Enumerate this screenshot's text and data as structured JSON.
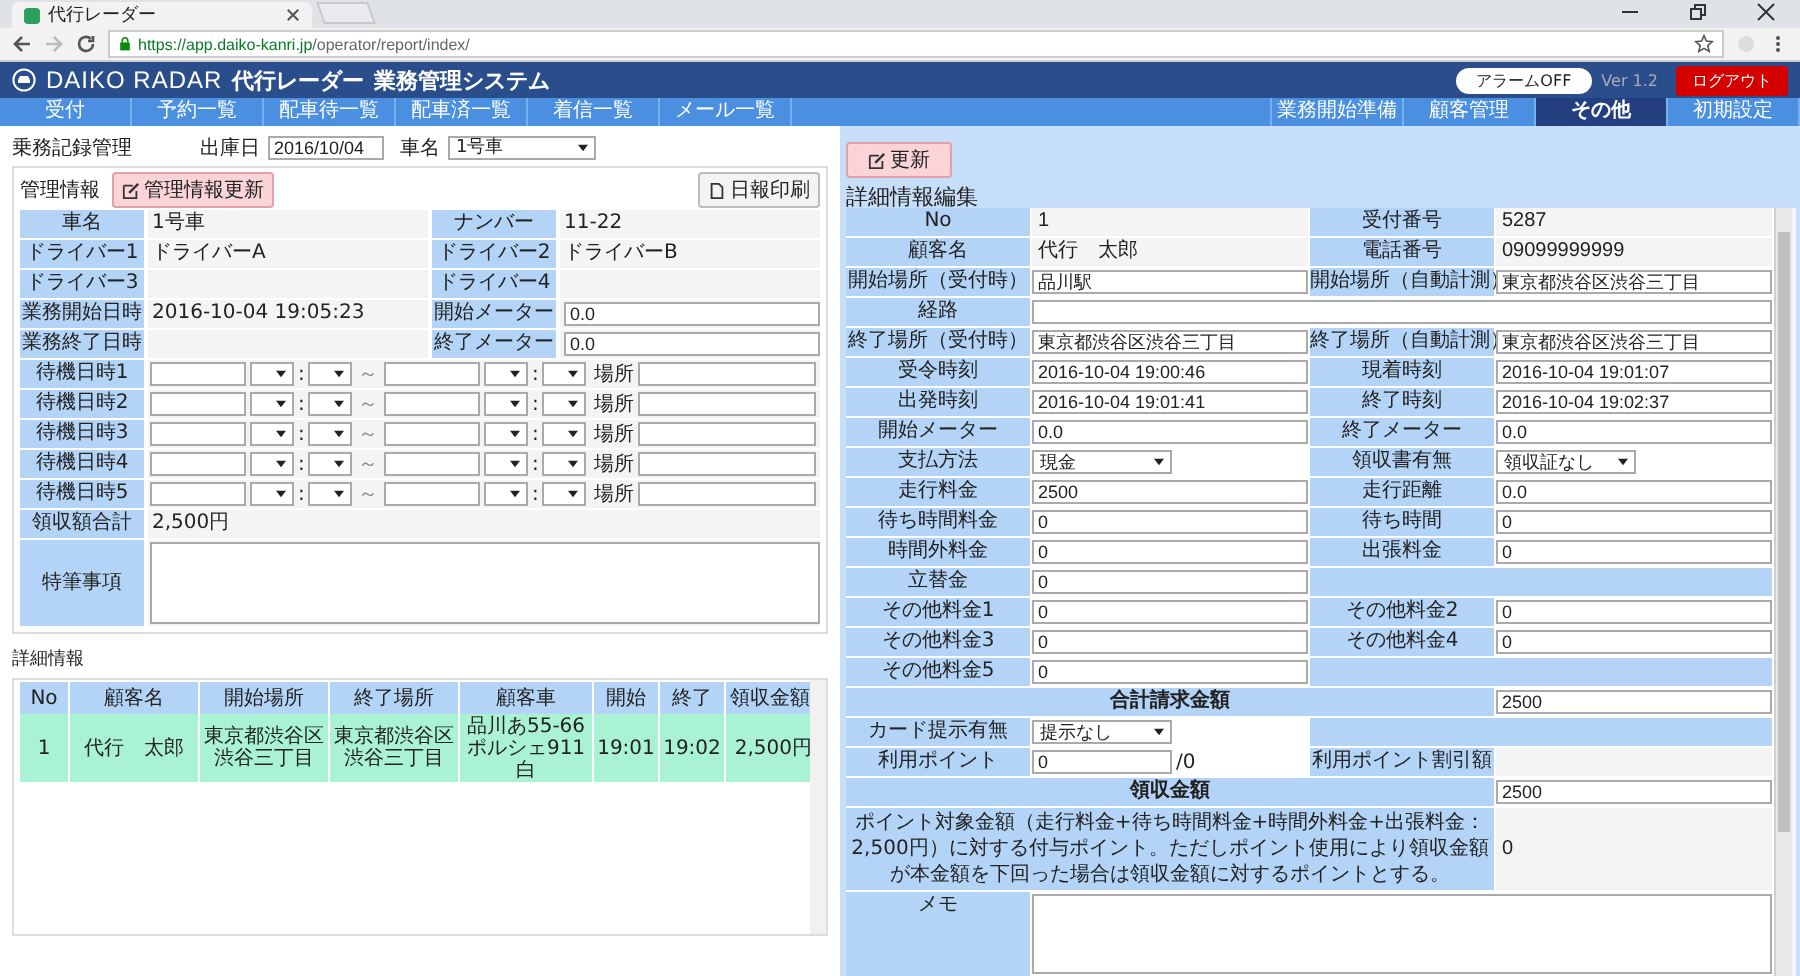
{
  "browser": {
    "tab_title": "代行レーダー",
    "url_host": "https://app.daiko-kanri.jp",
    "url_path": "/operator/report/index/"
  },
  "header": {
    "logo": "DAIKO RADAR",
    "app_name": "代行レーダー",
    "system_name": "業務管理システム",
    "alarm_button": "アラームOFF",
    "version": "Ver 1.2",
    "logout_button": "ログアウト"
  },
  "nav_left": [
    {
      "label": "受付",
      "selected": false
    },
    {
      "label": "予約一覧",
      "selected": false
    },
    {
      "label": "配車待一覧",
      "selected": false
    },
    {
      "label": "配車済一覧",
      "selected": false
    },
    {
      "label": "着信一覧",
      "selected": false
    },
    {
      "label": "メール一覧",
      "selected": false
    }
  ],
  "nav_right": [
    {
      "label": "業務開始準備",
      "selected": false
    },
    {
      "label": "顧客管理",
      "selected": false
    },
    {
      "label": "その他",
      "selected": true
    },
    {
      "label": "初期設定",
      "selected": false
    }
  ],
  "record": {
    "title": "乗務記録管理",
    "date_label": "出庫日",
    "date_value": "2016/10/04",
    "car_label": "車名",
    "car_value": "1号車"
  },
  "management": {
    "title": "管理情報",
    "update_button": "管理情報更新",
    "print_button": "日報印刷",
    "rows": [
      [
        {
          "label": "車名",
          "kind": "text",
          "value": "1号車"
        },
        {
          "label": "ナンバー",
          "kind": "text",
          "value": "11-22"
        }
      ],
      [
        {
          "label": "ドライバー1",
          "kind": "text",
          "value": "ドライバーA"
        },
        {
          "label": "ドライバー2",
          "kind": "text",
          "value": "ドライバーB"
        }
      ],
      [
        {
          "label": "ドライバー3",
          "kind": "text"
        },
        {
          "label": "ドライバー4",
          "kind": "text"
        }
      ],
      [
        {
          "label": "業務開始日時",
          "kind": "text",
          "value": "2016-10-04 19:05:23"
        },
        {
          "label": "開始メーター",
          "kind": "input",
          "value": "0.0"
        }
      ],
      [
        {
          "label": "業務終了日時",
          "kind": "text"
        },
        {
          "label": "終了メーター",
          "kind": "input",
          "value": "0.0"
        }
      ]
    ],
    "wait_rows": [
      {
        "label": "待機日時1",
        "colon_1": ":",
        "tilde": "～",
        "colon_2": ":",
        "place_label": "場所"
      },
      {
        "label": "待機日時2",
        "colon_1": ":",
        "tilde": "～",
        "colon_2": ":",
        "place_label": "場所"
      },
      {
        "label": "待機日時3",
        "colon_1": ":",
        "tilde": "～",
        "colon_2": ":",
        "place_label": "場所"
      },
      {
        "label": "待機日時4",
        "colon_1": ":",
        "tilde": "～",
        "colon_2": ":",
        "place_label": "場所"
      },
      {
        "label": "待機日時5",
        "colon_1": ":",
        "tilde": "～",
        "colon_2": ":",
        "place_label": "場所"
      }
    ],
    "total_label": "領収額合計",
    "total_value": "2,500円",
    "remarks_label": "特筆事項"
  },
  "details": {
    "title": "詳細情報",
    "columns": [
      "No",
      "顧客名",
      "開始場所",
      "終了場所",
      "顧客車",
      "開始",
      "終了",
      "領収金額"
    ],
    "rows": [
      {
        "selected": true,
        "cells": [
          "1",
          "代行　太郎",
          "東京都渋谷区渋谷三丁目",
          "東京都渋谷区渋谷三丁目",
          "品川あ55-66　ポルシェ911　白",
          "19:01",
          "19:02",
          "2,500円"
        ]
      }
    ]
  },
  "edit": {
    "update_button": "更新",
    "title": "詳細情報編集",
    "rows": [
      [
        {
          "kind": "label",
          "text": "No"
        },
        {
          "kind": "text",
          "text": "1"
        },
        {
          "kind": "label",
          "text": "受付番号"
        },
        {
          "kind": "text",
          "text": "5287"
        }
      ],
      [
        {
          "kind": "label",
          "text": "顧客名"
        },
        {
          "kind": "text",
          "text": "代行　太郎"
        },
        {
          "kind": "label",
          "text": "電話番号"
        },
        {
          "kind": "text",
          "text": "09099999999"
        }
      ],
      [
        {
          "kind": "label",
          "text": "開始場所（受付時）"
        },
        {
          "kind": "input",
          "text": "品川駅"
        },
        {
          "kind": "label",
          "text": "開始場所（自動計測）"
        },
        {
          "kind": "input",
          "text": "東京都渋谷区渋谷三丁目"
        }
      ],
      [
        {
          "kind": "label",
          "text": "経路"
        },
        {
          "kind": "wide_input"
        }
      ],
      [
        {
          "kind": "label",
          "text": "終了場所（受付時）"
        },
        {
          "kind": "input",
          "text": "東京都渋谷区渋谷三丁目"
        },
        {
          "kind": "label",
          "text": "終了場所（自動計測）"
        },
        {
          "kind": "input",
          "text": "東京都渋谷区渋谷三丁目"
        }
      ],
      [
        {
          "kind": "label",
          "text": "受令時刻"
        },
        {
          "kind": "input",
          "text": "2016-10-04 19:00:46"
        },
        {
          "kind": "label",
          "text": "現着時刻"
        },
        {
          "kind": "input",
          "text": "2016-10-04 19:01:07"
        }
      ],
      [
        {
          "kind": "label",
          "text": "出発時刻"
        },
        {
          "kind": "input",
          "text": "2016-10-04 19:01:41"
        },
        {
          "kind": "label",
          "text": "終了時刻"
        },
        {
          "kind": "input",
          "text": "2016-10-04 19:02:37"
        }
      ],
      [
        {
          "kind": "label",
          "text": "開始メーター"
        },
        {
          "kind": "input",
          "text": "0.0"
        },
        {
          "kind": "label",
          "text": "終了メーター"
        },
        {
          "kind": "input",
          "text": "0.0"
        }
      ],
      [
        {
          "kind": "label",
          "text": "支払方法"
        },
        {
          "kind": "select",
          "text": "現金"
        },
        {
          "kind": "label",
          "text": "領収書有無"
        },
        {
          "kind": "select",
          "text": "領収証なし"
        }
      ],
      [
        {
          "kind": "label",
          "text": "走行料金"
        },
        {
          "kind": "input",
          "text": "2500"
        },
        {
          "kind": "label",
          "text": "走行距離"
        },
        {
          "kind": "input",
          "text": "0.0"
        }
      ],
      [
        {
          "kind": "label",
          "text": "待ち時間料金"
        },
        {
          "kind": "input",
          "text": "0"
        },
        {
          "kind": "label",
          "text": "待ち時間"
        },
        {
          "kind": "input",
          "text": "0"
        }
      ],
      [
        {
          "kind": "label",
          "text": "時間外料金"
        },
        {
          "kind": "input",
          "text": "0"
        },
        {
          "kind": "label",
          "text": "出張料金"
        },
        {
          "kind": "input",
          "text": "0"
        }
      ],
      [
        {
          "kind": "label",
          "text": "立替金"
        },
        {
          "kind": "input",
          "text": "0"
        },
        {
          "kind": "filler"
        }
      ],
      [
        {
          "kind": "label",
          "text": "その他料金1"
        },
        {
          "kind": "input",
          "text": "0"
        },
        {
          "kind": "label",
          "text": "その他料金2"
        },
        {
          "kind": "input",
          "text": "0"
        }
      ],
      [
        {
          "kind": "label",
          "text": "その他料金3"
        },
        {
          "kind": "input",
          "text": "0"
        },
        {
          "kind": "label",
          "text": "その他料金4"
        },
        {
          "kind": "input",
          "text": "0"
        }
      ],
      [
        {
          "kind": "label",
          "text": "その他料金5"
        },
        {
          "kind": "input",
          "text": "0"
        },
        {
          "kind": "filler"
        }
      ],
      [
        {
          "kind": "heading",
          "text": "合計請求金額"
        },
        {
          "kind": "input",
          "text": "2500"
        }
      ],
      [
        {
          "kind": "label",
          "text": "カード提示有無"
        },
        {
          "kind": "select",
          "text": "提示なし"
        },
        {
          "kind": "filler"
        }
      ],
      [
        {
          "kind": "label",
          "text": "利用ポイント"
        },
        {
          "kind": "points",
          "text": "0",
          "suffix": "/0"
        },
        {
          "kind": "label",
          "text": "利用ポイント割引額"
        },
        {
          "kind": "text"
        }
      ],
      [
        {
          "kind": "heading",
          "text": "領収金額"
        },
        {
          "kind": "input",
          "text": "2500"
        }
      ],
      [
        {
          "kind": "note",
          "text": "ポイント対象金額（走行料金+待ち時間料金+時間外料金+出張料金：2,500円）に対する付与ポイント。ただしポイント使用により領収金額が本金額を下回った場合は領収金額に対するポイントとする。"
        },
        {
          "kind": "text",
          "text": "0"
        }
      ],
      [
        {
          "kind": "label",
          "text": "メモ"
        },
        {
          "kind": "textarea"
        }
      ]
    ]
  }
}
